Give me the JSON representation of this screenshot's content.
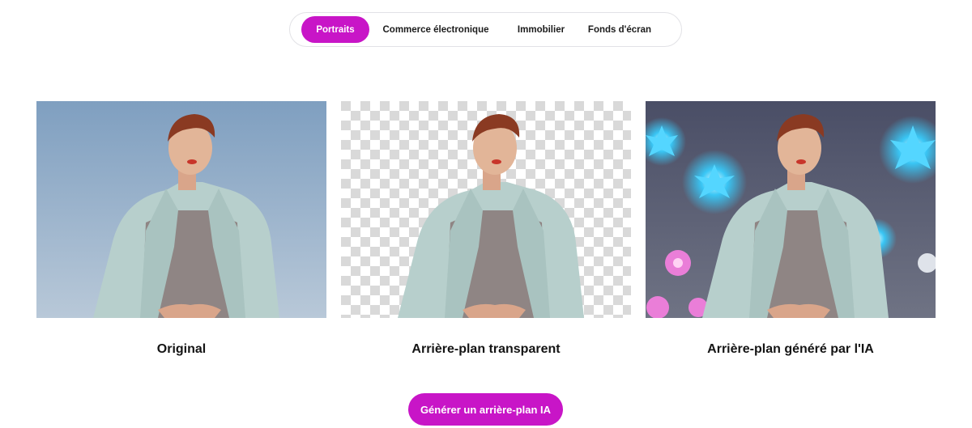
{
  "tabs": [
    {
      "label": "Portraits",
      "active": true
    },
    {
      "label": "Commerce électronique",
      "active": false
    },
    {
      "label": "Immobilier",
      "active": false
    },
    {
      "label": "Fonds d'écran",
      "active": false
    }
  ],
  "cards": [
    {
      "caption": "Original",
      "background": "sky-blue"
    },
    {
      "caption": "Arrière-plan transparent",
      "background": "transparent-checkerboard"
    },
    {
      "caption": "Arrière-plan généré par l'IA",
      "background": "ai-glowing-flowers"
    }
  ],
  "cta": {
    "label": "Générer un arrière-plan IA"
  },
  "colors": {
    "accent": "#c815c7",
    "coat": "#b7cfcc",
    "shirt": "#8f8584"
  }
}
